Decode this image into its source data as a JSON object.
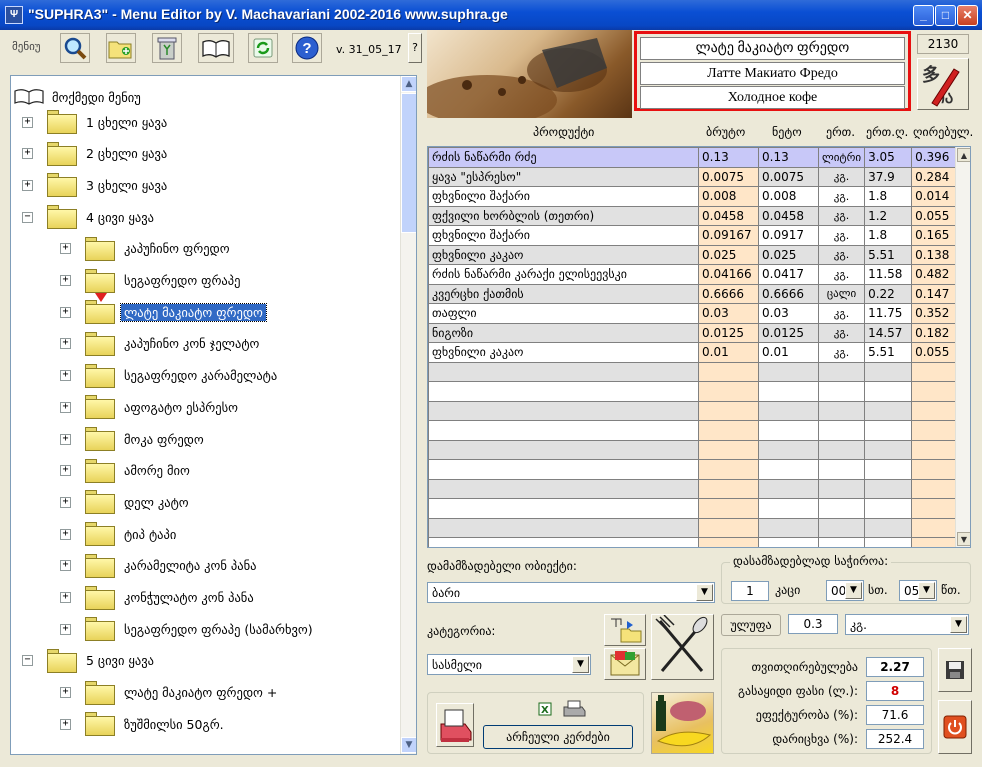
{
  "window": {
    "title": "\"SUPHRA3\" - Menu Editor by V. Machavariani  2002-2016  www.suphra.ge"
  },
  "toolbar": {
    "menu_label": "მენიუ",
    "version": "v. 31_05_17",
    "help_label": "?"
  },
  "code": "2130",
  "names": {
    "georgian": "ლატე მაკიატო ფრედო",
    "russian": "Латте Макиато Фредо",
    "russian_sub": "Холодное кофе"
  },
  "tree": {
    "root": "მოქმედი მენიუ",
    "items": [
      {
        "label": "1 ცხელი ყავა",
        "level": 1,
        "exp": "+"
      },
      {
        "label": "2 ცხელი ყავა",
        "level": 1,
        "exp": "+"
      },
      {
        "label": "3 ცხელი ყავა",
        "level": 1,
        "exp": "+"
      },
      {
        "label": "4 ცივი ყავა",
        "level": 1,
        "exp": "−"
      },
      {
        "label": "კაპუჩინო ფრედო",
        "level": 2,
        "exp": "+"
      },
      {
        "label": "სეგაფრედო ფრაპე",
        "level": 2,
        "exp": "+"
      },
      {
        "label": "ლატე მაკიატო ფრედო",
        "level": 2,
        "exp": "+",
        "selected": true
      },
      {
        "label": "კაპუჩინო კონ ჯელატო",
        "level": 2,
        "exp": "+"
      },
      {
        "label": "სეგაფრედო კარამელატა",
        "level": 2,
        "exp": "+"
      },
      {
        "label": "აფოგატო ესპრესო",
        "level": 2,
        "exp": "+"
      },
      {
        "label": "მოკა ფრედო",
        "level": 2,
        "exp": "+"
      },
      {
        "label": "ამორე მიო",
        "level": 2,
        "exp": "+"
      },
      {
        "label": "დელ კატო",
        "level": 2,
        "exp": "+"
      },
      {
        "label": "ტიპ ტაპი",
        "level": 2,
        "exp": "+"
      },
      {
        "label": "კარამელიტა კონ პანა",
        "level": 2,
        "exp": "+"
      },
      {
        "label": "კონჭულატო კონ პანა",
        "level": 2,
        "exp": "+"
      },
      {
        "label": "სეგაფრედო ფრაპე (სამარხვო)",
        "level": 2,
        "exp": "+"
      },
      {
        "label": "5 ცივი ყავა",
        "level": 1,
        "exp": "−"
      },
      {
        "label": "ლატე მაკიატო ფრედო +",
        "level": 2,
        "exp": "+"
      },
      {
        "label": "ზუშმილსი 50გრ.",
        "level": 2,
        "exp": "+"
      }
    ]
  },
  "grid": {
    "headers": [
      "პროდუქტი",
      "ბრუტო",
      "ნეტო",
      "ერთ.",
      "ერთ.ღ.",
      "ღირებულ."
    ],
    "rows": [
      [
        "რძის ნაწარმი რძე",
        "0.13",
        "0.13",
        "ლიტრი",
        "3.05",
        "0.396"
      ],
      [
        "ყავა \"ესპრესო\"",
        "0.0075",
        "0.0075",
        "კგ.",
        "37.9",
        "0.284"
      ],
      [
        "ფხვნილი შაქარი",
        "0.008",
        "0.008",
        "კგ.",
        "1.8",
        "0.014"
      ],
      [
        "ფქვილი ხორბლის (თეთრი)",
        "0.0458",
        "0.0458",
        "კგ.",
        "1.2",
        "0.055"
      ],
      [
        "ფხვნილი შაქარი",
        "0.09167",
        "0.0917",
        "კგ.",
        "1.8",
        "0.165"
      ],
      [
        "ფხვნილი კაკაო",
        "0.025",
        "0.025",
        "კგ.",
        "5.51",
        "0.138"
      ],
      [
        "რძის ნაწარმი კარაქი ელისეევსკი",
        "0.04166",
        "0.0417",
        "კგ.",
        "11.58",
        "0.482"
      ],
      [
        "კვერცხი ქათმის",
        "0.6666",
        "0.6666",
        "ცალი",
        "0.22",
        "0.147"
      ],
      [
        "თაფლი",
        "0.03",
        "0.03",
        "კგ.",
        "11.75",
        "0.352"
      ],
      [
        "ნიგოზი",
        "0.0125",
        "0.0125",
        "კგ.",
        "14.57",
        "0.182"
      ],
      [
        "ფხვნილი კაკაო",
        "0.01",
        "0.01",
        "კგ.",
        "5.51",
        "0.055"
      ]
    ],
    "empty_rows": 10
  },
  "bottom": {
    "object_label": "დამამზადებელი ობიექტი:",
    "object_value": "ბარი",
    "time_label": "დასამზადებლად საჭიროა:",
    "persons": "1",
    "persons_unit": "კაცი",
    "hours": "00",
    "hours_unit": "სთ.",
    "minutes": "05",
    "minutes_unit": "წთ.",
    "category_label": "კატეგორია:",
    "category_value": "სასმელი",
    "portion_button": "ულუფა",
    "portion_value": "0.3",
    "portion_unit": "კგ.",
    "archive_button": "არჩეული კერძები",
    "cost_label": "თვითღირებულება",
    "cost_value": "2.27",
    "price_label": "გასაყიდი ფასი (ლ.):",
    "price_value": "8",
    "efficiency_label": "ეფექტურობა (%):",
    "efficiency_value": "71.6",
    "markup_label": "დარიცხვა (%):",
    "markup_value": "252.4"
  },
  "colors": {
    "title_blue": "#0a4fd4",
    "highlight_red": "#e81010",
    "selection_blue": "#316ac5",
    "peach": "#ffe6c8",
    "price_red": "#d00000"
  }
}
